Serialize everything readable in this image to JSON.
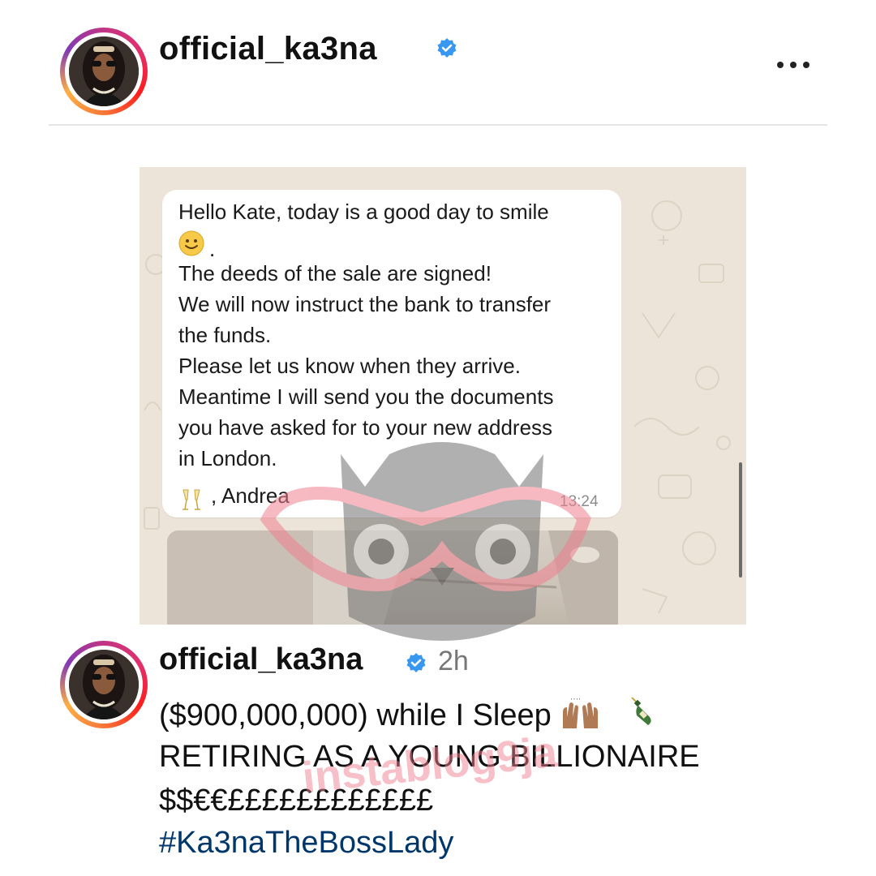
{
  "post": {
    "username": "official_ka3na",
    "more_icon": "more-horizontal-icon"
  },
  "chat": {
    "lines": [
      "Hello Kate, today is a good day to smile",
      "The deeds of the sale are signed!",
      "We will now instruct the bank to transfer",
      "the funds.",
      "Please let us know when they arrive.",
      "Meantime I will send you the documents",
      "you have asked for to your new address",
      "in London."
    ],
    "smile_suffix": ".",
    "signature": ", Andrea",
    "time": "13:24"
  },
  "caption": {
    "username": "official_ka3na",
    "time_ago": "2h",
    "line1": "($900,000,000) while I Sleep",
    "line2": "RETIRING AS A YOUNG BILLIONAIRE",
    "line3": "$$€€££££££££££££",
    "hashtag": "#Ka3naTheBossLady"
  },
  "watermark": {
    "text": "instablog9ja"
  },
  "colors": {
    "verified_blue": "#3897f0",
    "hashtag_blue": "#00376b",
    "watermark_pink": "#f08090"
  }
}
